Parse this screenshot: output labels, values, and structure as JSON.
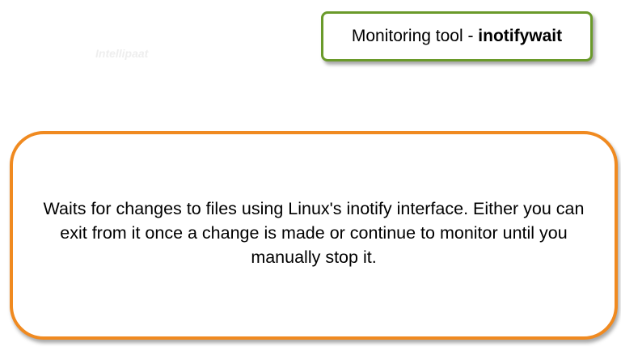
{
  "title": {
    "prefix": "Monitoring tool - ",
    "tool_name": "inotifywait",
    "border_color": "#6a9a2a"
  },
  "content": {
    "text": "Waits for changes to files using Linux's inotify interface. Either you can exit from it once a change is made or continue to monitor until you manually stop it.",
    "border_color": "#f08a20"
  },
  "watermark": {
    "text": "Intellipaat"
  }
}
